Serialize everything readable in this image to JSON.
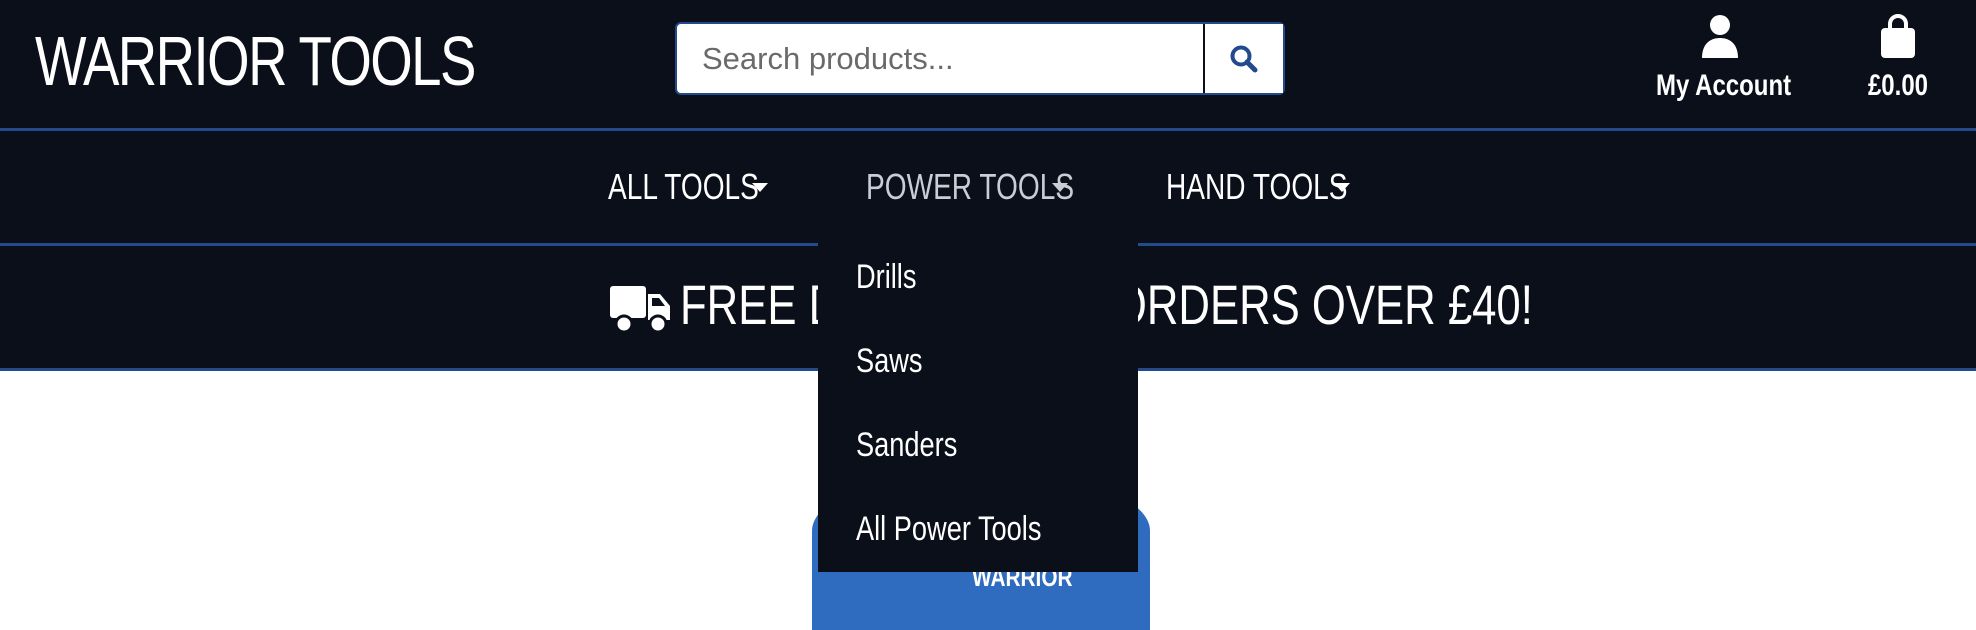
{
  "header": {
    "logo": "WARRIOR TOOLS",
    "search": {
      "placeholder": "Search products...",
      "icon": "search-icon"
    },
    "account": {
      "label": "My Account",
      "icon": "user-icon"
    },
    "cart": {
      "label": "£0.00",
      "icon": "shopping-bag-icon"
    }
  },
  "nav": {
    "items": [
      {
        "label": "ALL TOOLS"
      },
      {
        "label": "POWER TOOLS"
      },
      {
        "label": "HAND TOOLS"
      }
    ]
  },
  "banner": {
    "icon": "truck-icon",
    "text": "FREE DELIVERY ON ORDERS OVER £40!"
  },
  "dropdown": {
    "items": [
      "Drills",
      "Saws",
      "Sanders",
      "All Power Tools"
    ]
  },
  "hero": {
    "brand_word": "WARRIOR"
  },
  "colors": {
    "dark": "#0b0f1a",
    "accent": "#234a8c",
    "brand_blue": "#2f6cc0"
  }
}
